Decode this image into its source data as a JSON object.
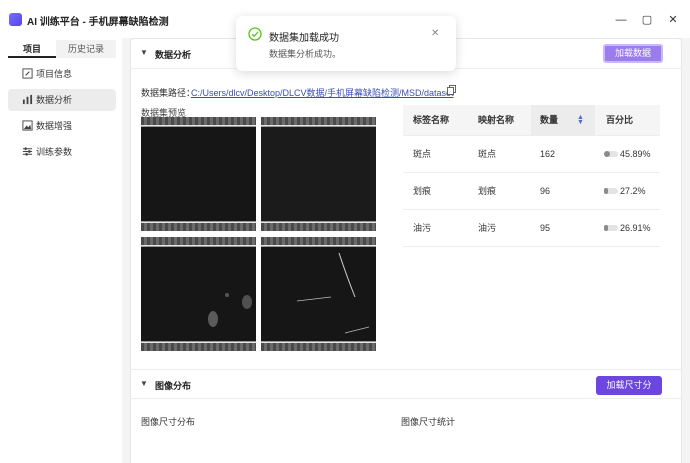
{
  "app": {
    "title": "AI 训练平台 - 手机屏幕缺陷检测",
    "window_controls": {
      "minimize": "—",
      "maximize": "▢",
      "close": "✕"
    }
  },
  "sidebar": {
    "tabs": [
      {
        "label": "项目",
        "active": true
      },
      {
        "label": "历史记录",
        "active": false
      }
    ],
    "items": [
      {
        "label": "项目信息",
        "icon": "edit-icon",
        "active": false
      },
      {
        "label": "数据分析",
        "icon": "bar-chart-icon",
        "active": true
      },
      {
        "label": "数据增强",
        "icon": "image-icon",
        "active": false
      },
      {
        "label": "训练参数",
        "icon": "sliders-icon",
        "active": false
      }
    ]
  },
  "analysis": {
    "title": "数据分析",
    "load_button": "加载数据集",
    "path_label": "数据集路径：",
    "path_value": "C:/Users/dlcv/Desktop/DLCV数据/手机屏幕缺陷检测/MSD/dataset",
    "preview_label": "数据集预览",
    "table": {
      "headers": {
        "label": "标签名称",
        "mapped": "映射名称",
        "count": "数量",
        "percent": "百分比"
      },
      "rows": [
        {
          "label": "斑点",
          "mapped": "斑点",
          "count": "162",
          "percent": "45.89%",
          "fraction": 0.4589
        },
        {
          "label": "划痕",
          "mapped": "划痕",
          "count": "96",
          "percent": "27.2%",
          "fraction": 0.272
        },
        {
          "label": "油污",
          "mapped": "油污",
          "count": "95",
          "percent": "26.91%",
          "fraction": 0.2691
        }
      ]
    }
  },
  "image_dist": {
    "title": "图像分布",
    "load_button": "加载尺寸分布",
    "size_dist_label": "图像尺寸分布",
    "size_stats_label": "图像尺寸统计"
  },
  "toast": {
    "title": "数据集加载成功",
    "message": "数据集分析成功。",
    "close": "✕"
  },
  "colors": {
    "accent": "#6b46e0",
    "success": "#52c41a",
    "link": "#3a4fb5"
  }
}
